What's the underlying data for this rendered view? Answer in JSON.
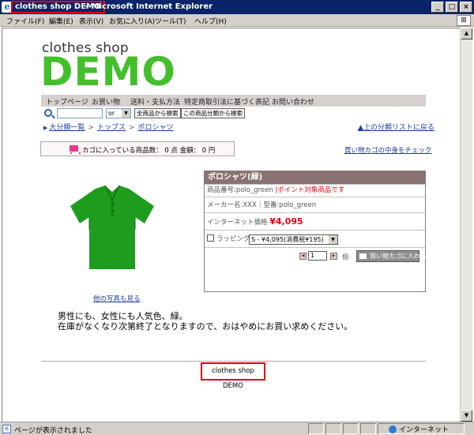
{
  "window": {
    "title_site": "clothes shop DEMO",
    "title_sep": "-",
    "title_app": "Microsoft Internet Explorer",
    "ie_logo": "e",
    "btn_min": "_",
    "btn_max": "□",
    "btn_close": "×",
    "menus": [
      "ファイル(F)",
      "編集(E)",
      "表示(V)",
      "お気に入り(A)",
      "ツール(T)",
      "ヘルプ(H)"
    ],
    "win_logo": "⊞"
  },
  "scrollbar": {
    "up": "▲",
    "down": "▼"
  },
  "status": {
    "icon": "e",
    "text": "ページが表示されました",
    "zone": "インターネット"
  },
  "logo": {
    "small": "clothes shop",
    "big": "DEMO"
  },
  "nav": [
    "トップページ",
    "お買い物",
    "送料・支払方法",
    "特定商取引法に基づく表記",
    "お問い合わせ"
  ],
  "search": {
    "value": "",
    "or_value": "or",
    "dropdown_arrow": "▼",
    "btn_all": "全商品から検索",
    "btn_category": "この商品分類から検索"
  },
  "breadcrumb": {
    "arrow": "▶",
    "items": [
      "大分類一覧",
      "トップス",
      "ポロシャツ"
    ],
    "sep": ">",
    "up_link": "▲上の分類リストに戻る"
  },
  "cart": {
    "text": "カゴに入っている商品数： 0 点  金額： 0 円",
    "link": "買い物カゴの中身をチェック"
  },
  "product": {
    "name": "ポロシャツ(緑)",
    "code_label": "商品番号:polo_green",
    "point_label": "|ポイント対象商品です",
    "maker_label": "メーカー名:XXX｜型番:polo_green",
    "price_label": "インターネット価格",
    "price": "¥4,095",
    "wrapping_label": "ラッピング",
    "size_option": "S - ¥4,095(消費税¥195)",
    "qty_minus": "◀",
    "qty_plus": "▶",
    "qty_value": "1",
    "qty_unit": "個",
    "add_to_cart": "買い物カゴに入れる",
    "photo_link": "他の写真も見る",
    "shirt_color": "#1e9c1e"
  },
  "description": {
    "line1": "男性にも、女性にも人気色、緑。",
    "line2": "在庫がなくなり次第終了となりますので、おはやめにお買い求めください。"
  },
  "footer": {
    "text": "clothes shop DEMO"
  }
}
